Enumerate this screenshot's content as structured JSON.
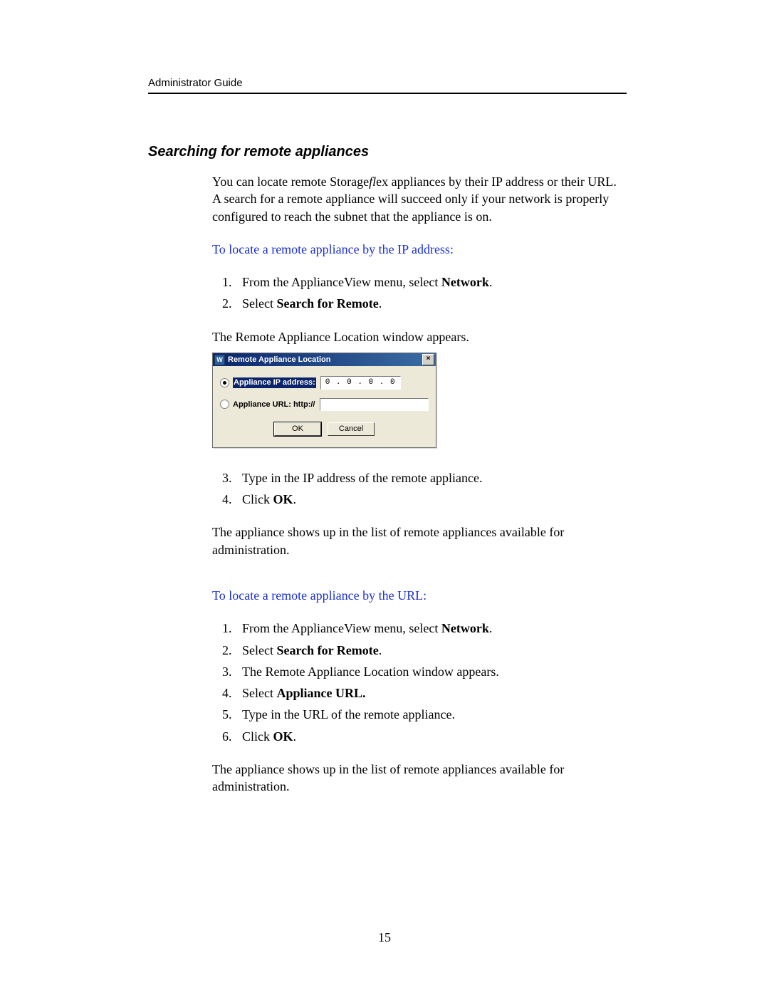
{
  "header": {
    "title": "Administrator Guide"
  },
  "section": {
    "heading": "Searching for remote appliances",
    "intro_pre": "You can locate remote Storage",
    "intro_em": "fl",
    "intro_post": "ex appliances by their IP address or their URL. A search for a remote appliance will succeed only if your network is properly configured to reach the subnet that the appliance is on.",
    "sub_ip": "To locate a remote appliance by the IP address:",
    "steps_ip_a": {
      "s1_pre": "From the ApplianceView menu, select ",
      "s1_bold": "Network",
      "s1_post": ".",
      "s2_pre": "Select ",
      "s2_bold": "Search for Remote",
      "s2_post": "."
    },
    "after_steps_ip_a": "The Remote Appliance Location window appears.",
    "steps_ip_b": {
      "s3": "Type in the IP address of the remote appliance.",
      "s4_pre": "Click ",
      "s4_bold": "OK",
      "s4_post": "."
    },
    "result_ip": "The appliance shows up in the list of remote appliances available for administration.",
    "sub_url": "To locate a remote appliance by the URL:",
    "steps_url": {
      "s1_pre": "From the ApplianceView menu, select ",
      "s1_bold": "Network",
      "s1_post": ".",
      "s2_pre": "Select ",
      "s2_bold": "Search for Remote",
      "s2_post": ".",
      "s3": "The Remote Appliance Location window appears.",
      "s4_pre": "Select ",
      "s4_bold": "Appliance URL.",
      "s5": "Type in the URL of the remote appliance.",
      "s6_pre": "Click ",
      "s6_bold": "OK",
      "s6_post": "."
    },
    "result_url": "The appliance shows up in the list of remote appliances available for administration."
  },
  "dialog": {
    "title": "Remote Appliance Location",
    "icon_glyph": "W",
    "close_glyph": "×",
    "radio_ip_label": "Appliance IP address:",
    "ip_value": "0 . 0 . 0 . 0",
    "radio_url_label": "Appliance URL:  http://",
    "ok_label": "OK",
    "cancel_label": "Cancel"
  },
  "page_number": "15"
}
